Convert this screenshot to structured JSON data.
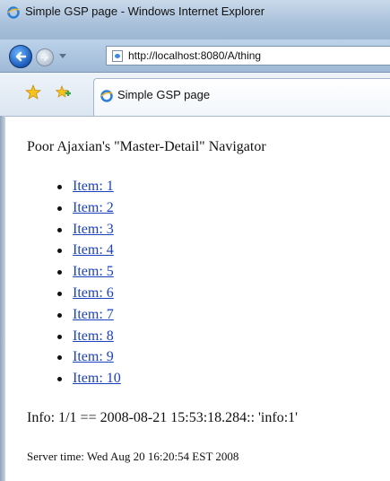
{
  "window": {
    "title": "Simple GSP page - Windows Internet Explorer"
  },
  "navigation": {
    "url": "http://localhost:8080/A/thing",
    "back_icon": "back-arrow-icon",
    "forward_icon": "forward-arrow-icon"
  },
  "tabs": {
    "active_tab_label": "Simple GSP page"
  },
  "page": {
    "heading": "Poor Ajaxian's \"Master-Detail\" Navigator",
    "items": [
      {
        "label": "Item: 1"
      },
      {
        "label": "Item: 2"
      },
      {
        "label": "Item: 3"
      },
      {
        "label": "Item: 4"
      },
      {
        "label": "Item: 5"
      },
      {
        "label": "Item: 6"
      },
      {
        "label": "Item: 7"
      },
      {
        "label": "Item: 8"
      },
      {
        "label": "Item: 9"
      },
      {
        "label": "Item: 10"
      }
    ],
    "info": "Info: 1/1 == 2008-08-21 15:53:18.284:: 'info:1'",
    "server_time": "Server time: Wed Aug 20 16:20:54 EST 2008"
  },
  "colors": {
    "link": "#1a3fbf",
    "chrome": "#a9c1db"
  }
}
